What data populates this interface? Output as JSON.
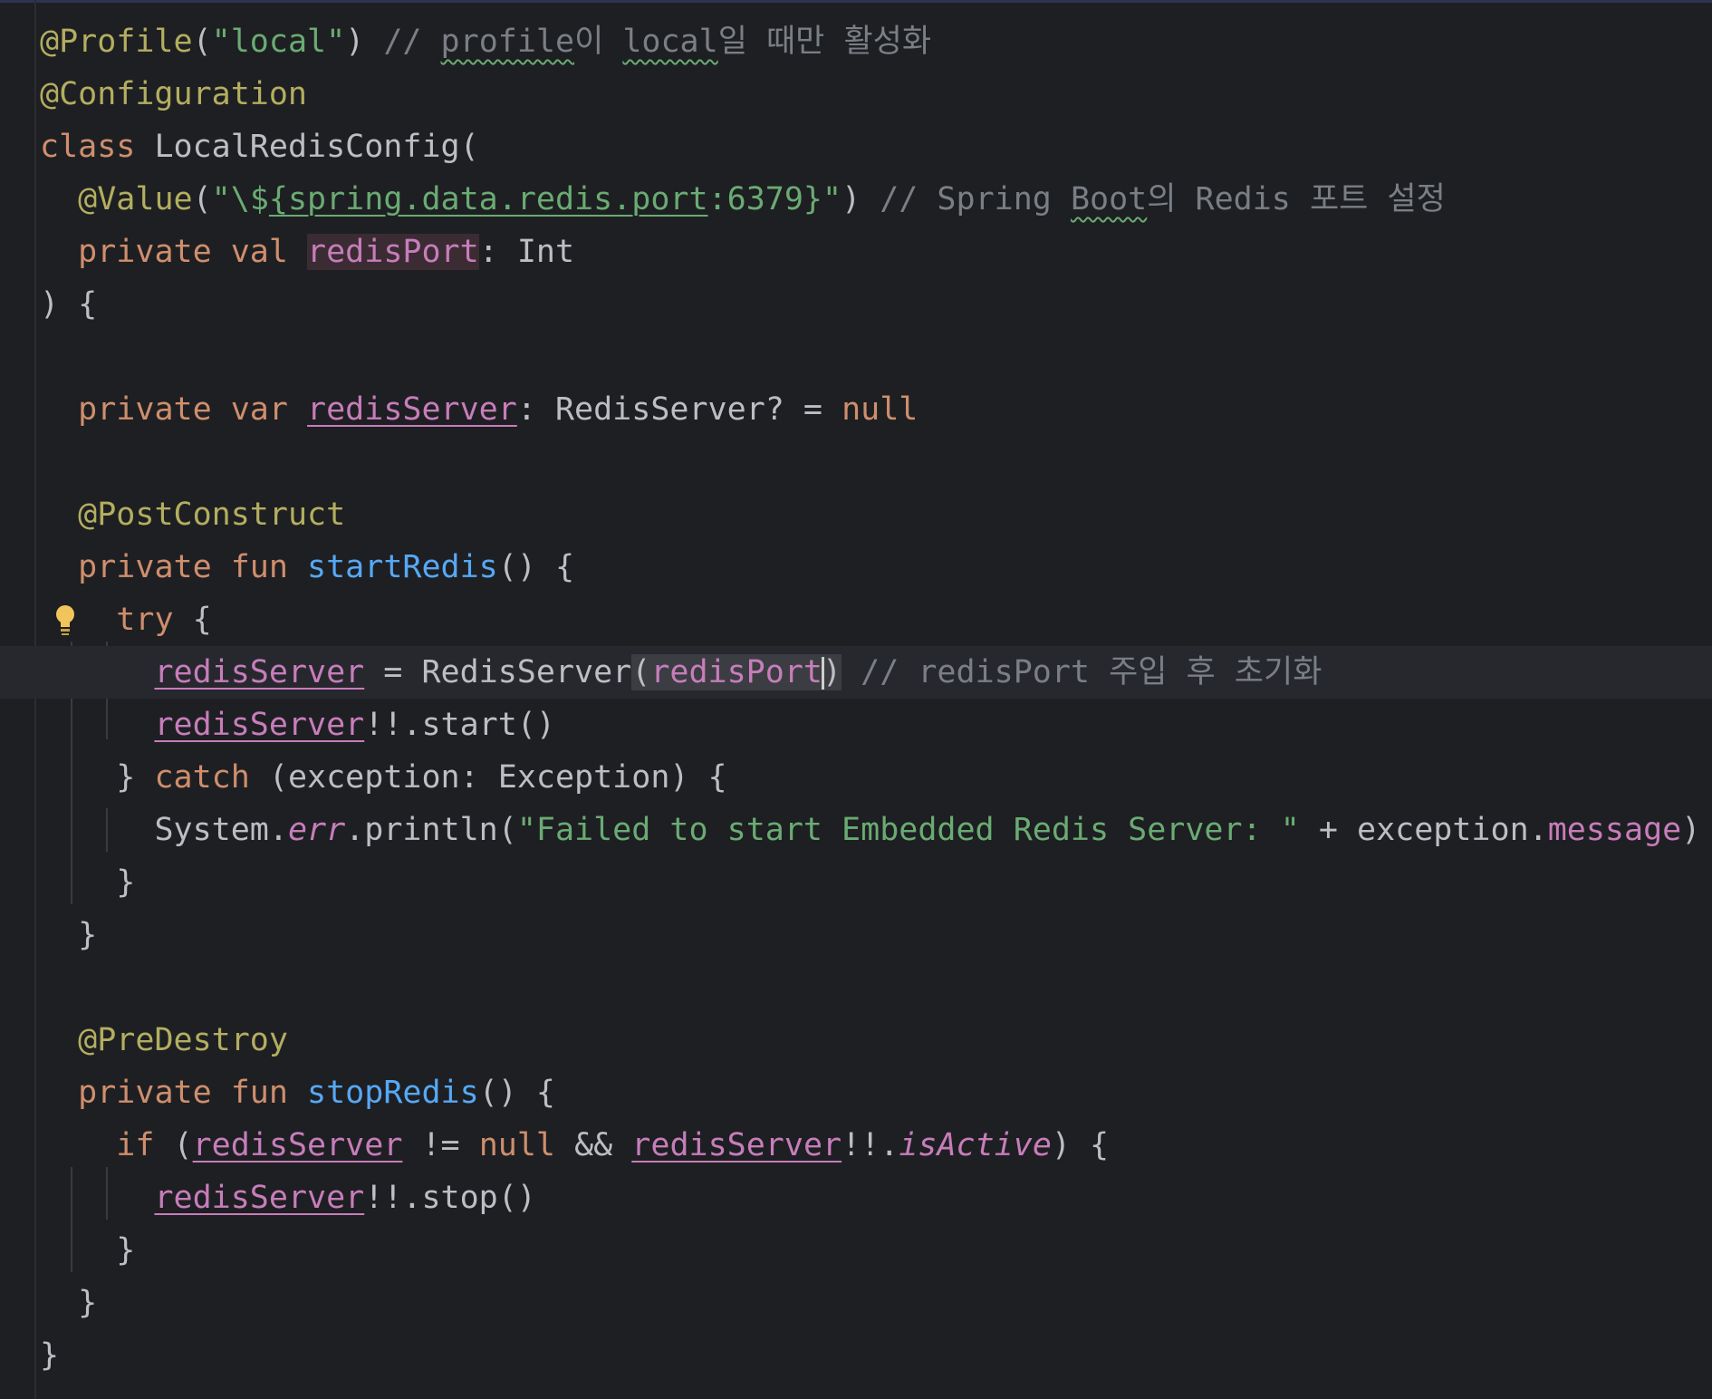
{
  "editor": {
    "language": "Kotlin",
    "theme_colors": {
      "background": "#1e1f22",
      "keyword": "#cf8e6d",
      "annotation": "#b3ae60",
      "string": "#6aab73",
      "comment": "#7a7e85",
      "function": "#56a8f5",
      "property": "#c77dbb",
      "plain": "#bcbec4"
    },
    "intention_icon": "lightbulb-icon",
    "line1": {
      "ann": "@Profile",
      "open": "(",
      "str": "\"local\"",
      "close": ")",
      "cmt_pre": " // ",
      "cmt_w1": "profile",
      "cmt_w1b": "이",
      "cmt_sp": " ",
      "cmt_w2": "local",
      "cmt_w2b": "일",
      "cmt_post": " 때만 활성화"
    },
    "line2": {
      "ann": "@Configuration"
    },
    "line3": {
      "kw": "class",
      "sp": " ",
      "name": "LocalRedisConfig("
    },
    "line4": {
      "indent": "  ",
      "ann": "@Value",
      "open": "(",
      "str_pre": "\"\\$",
      "str_tpl": "{spring.data.redis.port",
      "str_post": ":6379}\"",
      "close": ")",
      "cmt_pre": " // Spring ",
      "cmt_w": "Boot",
      "cmt_wb": "의",
      "cmt_post": " Redis 포트 설정"
    },
    "line5": {
      "indent": "  ",
      "kw": "private val",
      "sp": " ",
      "param": "redisPort",
      "rest": ": Int"
    },
    "line6": {
      "text": ") {"
    },
    "line8": {
      "indent": "  ",
      "kw": "private var",
      "sp": " ",
      "prop": "redisServer",
      "mid": ": RedisServer? = ",
      "kw2": "null"
    },
    "line10": {
      "indent": "  ",
      "ann": "@PostConstruct"
    },
    "line11": {
      "indent": "  ",
      "kw": "private fun",
      "sp": " ",
      "fn": "startRedis",
      "rest": "() {"
    },
    "line12": {
      "indent": "    ",
      "kw": "try",
      "rest": " {"
    },
    "line13": {
      "indent": "      ",
      "prop": "redisServer",
      "mid": " = RedisServer",
      "paren_open": "(",
      "param": "redisPort",
      "paren_close": ")",
      "cmt": " // redisPort 주입 후 초기화"
    },
    "line14": {
      "indent": "      ",
      "prop": "redisServer",
      "rest": "!!.start()"
    },
    "line15": {
      "indent": "    ",
      "brace": "} ",
      "kw": "catch",
      "rest": " (exception: Exception) {"
    },
    "line16": {
      "indent": "      ",
      "obj": "System.",
      "field": "err",
      "call": ".println(",
      "str": "\"Failed to start Embedded Redis Server: \"",
      "mid": " + exception.",
      "prop": "message",
      "close": ")"
    },
    "line17": {
      "indent": "    ",
      "text": "}"
    },
    "line18": {
      "indent": "  ",
      "text": "}"
    },
    "line20": {
      "indent": "  ",
      "ann": "@PreDestroy"
    },
    "line21": {
      "indent": "  ",
      "kw": "private fun",
      "sp": " ",
      "fn": "stopRedis",
      "rest": "() {"
    },
    "line22": {
      "indent": "    ",
      "kw": "if",
      "open": " (",
      "prop1": "redisServer",
      "mid1": " != ",
      "kw2": "null",
      "mid2": " && ",
      "prop2": "redisServer",
      "mid3": "!!.",
      "prop3": "isActive",
      "rest": ") {"
    },
    "line23": {
      "indent": "      ",
      "prop": "redisServer",
      "rest": "!!.stop()"
    },
    "line24": {
      "indent": "    ",
      "text": "}"
    },
    "line25": {
      "indent": "  ",
      "text": "}"
    },
    "line26": {
      "text": "}"
    }
  }
}
